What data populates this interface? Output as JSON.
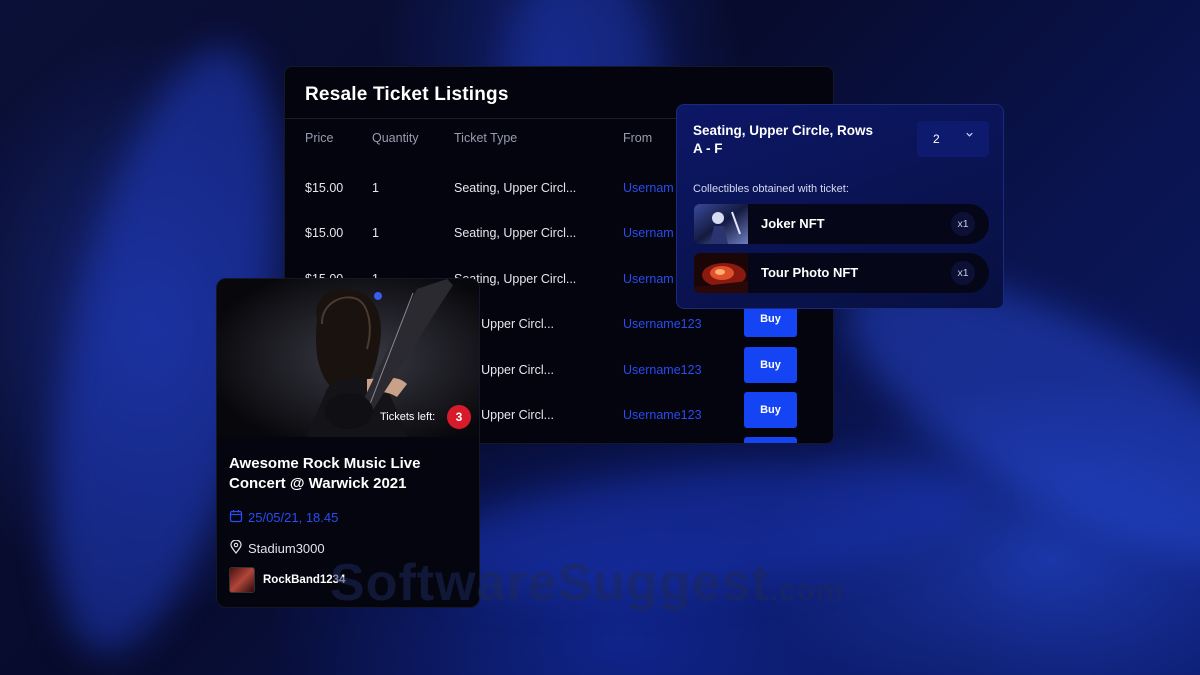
{
  "listings": {
    "title": "Resale Ticket Listings",
    "columns": [
      "Price",
      "Quantity",
      "Ticket Type",
      "From"
    ],
    "rows": [
      {
        "price": "$15.00",
        "quantity": "1",
        "type": "Seating, Upper Circl...",
        "from": "Usernam"
      },
      {
        "price": "$15.00",
        "quantity": "1",
        "type": "Seating, Upper Circl...",
        "from": "Usernam"
      },
      {
        "price": "$15.00",
        "quantity": "1",
        "type": "Seating, Upper Circl...",
        "from": "Usernam"
      },
      {
        "price": "",
        "quantity": "",
        "type": "ting, Upper Circl...",
        "from": "Username123",
        "buy": "Buy"
      },
      {
        "price": "",
        "quantity": "",
        "type": "ting, Upper Circl...",
        "from": "Username123",
        "buy": "Buy"
      },
      {
        "price": "",
        "quantity": "",
        "type": "ting, Upper Circl...",
        "from": "Username123",
        "buy": "Buy"
      }
    ]
  },
  "popup": {
    "title": "Seating, Upper Circle, Rows A - F",
    "quantity": "2",
    "subtitle": "Collectibles obtained with ticket:",
    "collectibles": [
      {
        "name": "Joker NFT",
        "count": "x1",
        "icon": "joker-thumbnail"
      },
      {
        "name": "Tour Photo NFT",
        "count": "x1",
        "icon": "tour-photo-thumbnail"
      }
    ]
  },
  "event": {
    "tickets_left_label": "Tickets left:",
    "tickets_left": "3",
    "title": "Awesome Rock Music Live Concert @ Warwick 2021",
    "date": "25/05/21, 18.45",
    "venue": "Stadium3000",
    "artist": "RockBand1234"
  },
  "watermark": {
    "main": "SoftwareSuggest",
    "suffix": ".com"
  },
  "colors": {
    "accent": "#1544f5",
    "link": "#2a4cf0",
    "badge": "#d81b2b",
    "panel": "#03040d"
  }
}
